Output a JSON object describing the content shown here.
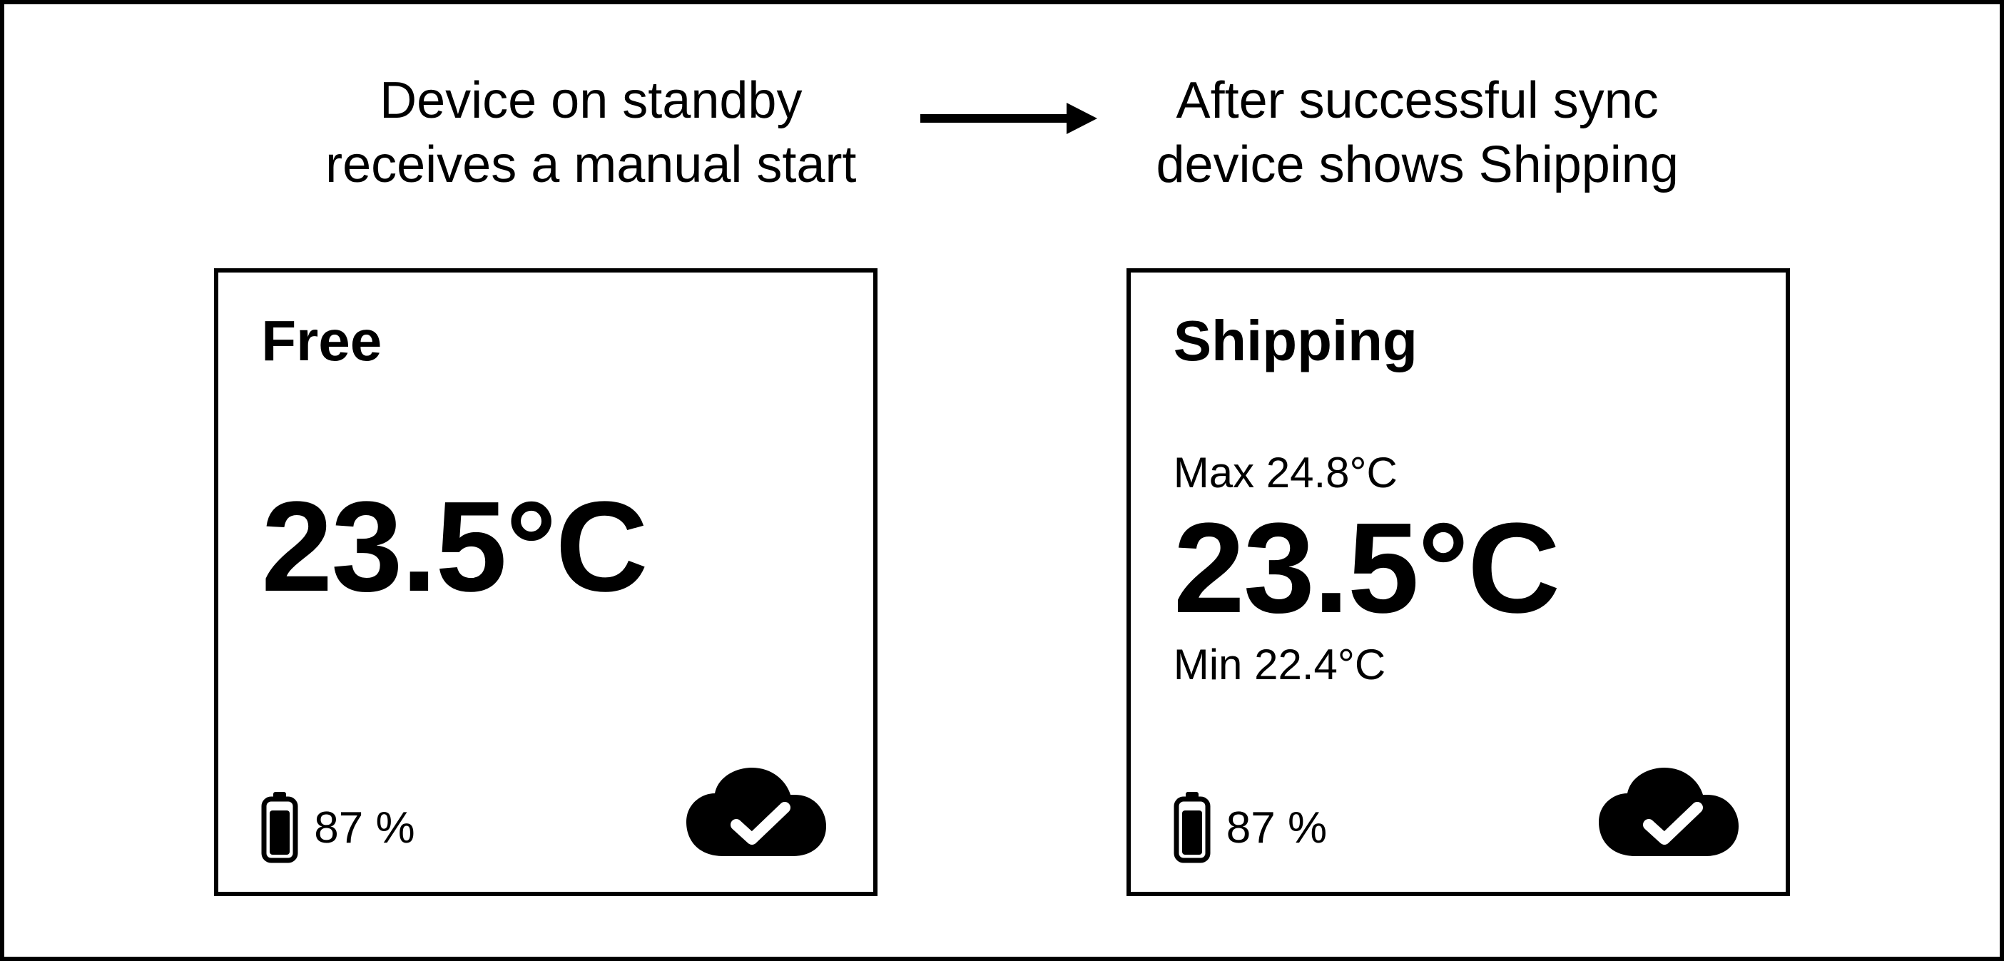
{
  "captions": {
    "left": "Device on standby\nreceives a manual start",
    "right": "After successful sync\ndevice shows Shipping"
  },
  "screens": {
    "left": {
      "status": "Free",
      "current_temp": "23.5°C",
      "battery_pct": "87 %"
    },
    "right": {
      "status": "Shipping",
      "max_label": "Max 24.8°C",
      "current_temp": "23.5°C",
      "min_label": "Min 22.4°C",
      "battery_pct": "87 %"
    }
  }
}
